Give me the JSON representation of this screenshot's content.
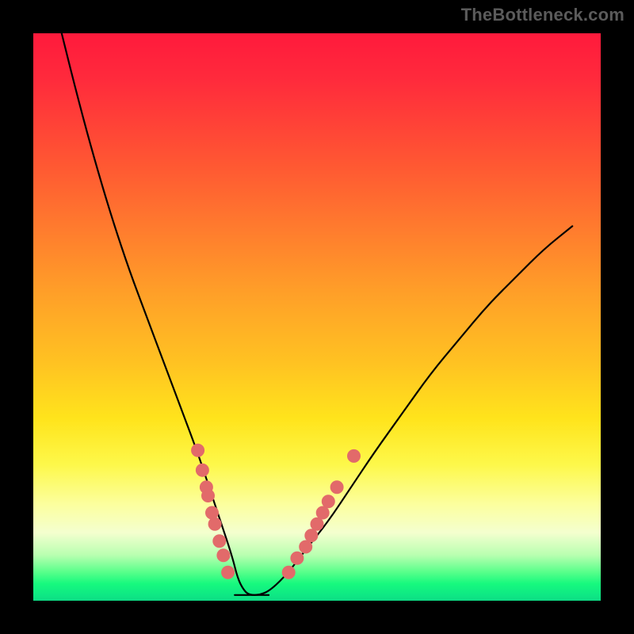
{
  "watermark_text": "TheBottleneck.com",
  "colors": {
    "frame": "#000000",
    "curve": "#000000",
    "marker": "#e26a6a",
    "gradient_top": "#ff1a3c",
    "gradient_bottom": "#0ddc85"
  },
  "chart_data": {
    "type": "line",
    "title": "",
    "xlabel": "",
    "ylabel": "",
    "xlim": [
      0,
      100
    ],
    "ylim": [
      0,
      100
    ],
    "grid": false,
    "legend": false,
    "note": "V-shaped bottleneck curve; y=0 is perfect match (green), higher y = more bottleneck (red). Pink dot clusters mark data points near the trough region.",
    "series": [
      {
        "name": "bottleneck-curve",
        "x": [
          5,
          8,
          11,
          14,
          17,
          20,
          23,
          26,
          29,
          31,
          33,
          35,
          36,
          37,
          38,
          40,
          42,
          45,
          48,
          52,
          56,
          60,
          65,
          70,
          75,
          80,
          85,
          90,
          95
        ],
        "y": [
          100,
          88,
          77,
          67,
          58,
          50,
          42,
          34,
          26,
          20,
          14,
          8,
          4,
          2,
          1,
          1,
          2,
          5,
          9,
          14,
          20,
          26,
          33,
          40,
          46,
          52,
          57,
          62,
          66
        ]
      }
    ],
    "trough_x_range": [
      35.5,
      41.5
    ],
    "marker_clusters": [
      {
        "name": "left-cluster",
        "points": [
          {
            "x": 29.0,
            "y": 26.5
          },
          {
            "x": 29.8,
            "y": 23.0
          },
          {
            "x": 30.5,
            "y": 20.0
          },
          {
            "x": 30.8,
            "y": 18.5
          },
          {
            "x": 31.5,
            "y": 15.5
          },
          {
            "x": 32.0,
            "y": 13.5
          },
          {
            "x": 32.8,
            "y": 10.5
          },
          {
            "x": 33.5,
            "y": 8.0
          },
          {
            "x": 34.3,
            "y": 5.0
          }
        ]
      },
      {
        "name": "right-cluster",
        "points": [
          {
            "x": 45.0,
            "y": 5.0
          },
          {
            "x": 46.5,
            "y": 7.5
          },
          {
            "x": 48.0,
            "y": 9.5
          },
          {
            "x": 49.0,
            "y": 11.5
          },
          {
            "x": 50.0,
            "y": 13.5
          },
          {
            "x": 51.0,
            "y": 15.5
          },
          {
            "x": 52.0,
            "y": 17.5
          },
          {
            "x": 53.5,
            "y": 20.0
          },
          {
            "x": 56.5,
            "y": 25.5
          }
        ]
      }
    ]
  }
}
